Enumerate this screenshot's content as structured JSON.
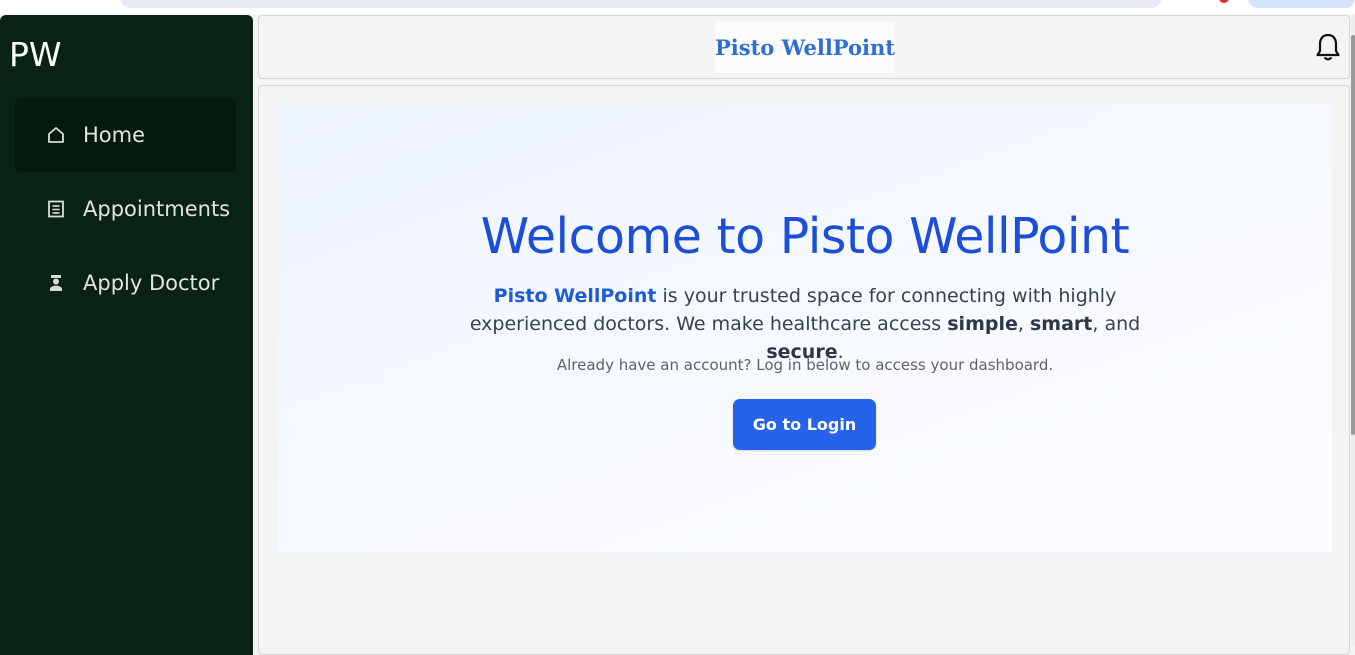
{
  "sidebar": {
    "logo": "PW",
    "items": [
      {
        "label": "Home",
        "icon": "home-icon",
        "active": true
      },
      {
        "label": "Appointments",
        "icon": "list-icon",
        "active": false
      },
      {
        "label": "Apply Doctor",
        "icon": "doctor-icon",
        "active": false
      }
    ]
  },
  "header": {
    "brand": "Pisto WellPoint",
    "notification_icon": "bell-icon"
  },
  "hero": {
    "title": "Welcome to Pisto WellPoint",
    "desc_highlight": "Pisto WellPoint",
    "desc_part1": " is your trusted space for connecting with highly experienced doctors. We make healthcare access ",
    "desc_bold1": "simple",
    "desc_sep1": ", ",
    "desc_bold2": "smart",
    "desc_sep2": ", and ",
    "desc_bold3": "secure",
    "desc_end": ".",
    "subtext": "Already have an account? Log in below to access your dashboard.",
    "button_label": "Go to Login"
  },
  "colors": {
    "sidebar_bg": "#082314",
    "accent": "#2563eb",
    "title": "#1d4ed8",
    "brand": "#2f6fd2"
  }
}
